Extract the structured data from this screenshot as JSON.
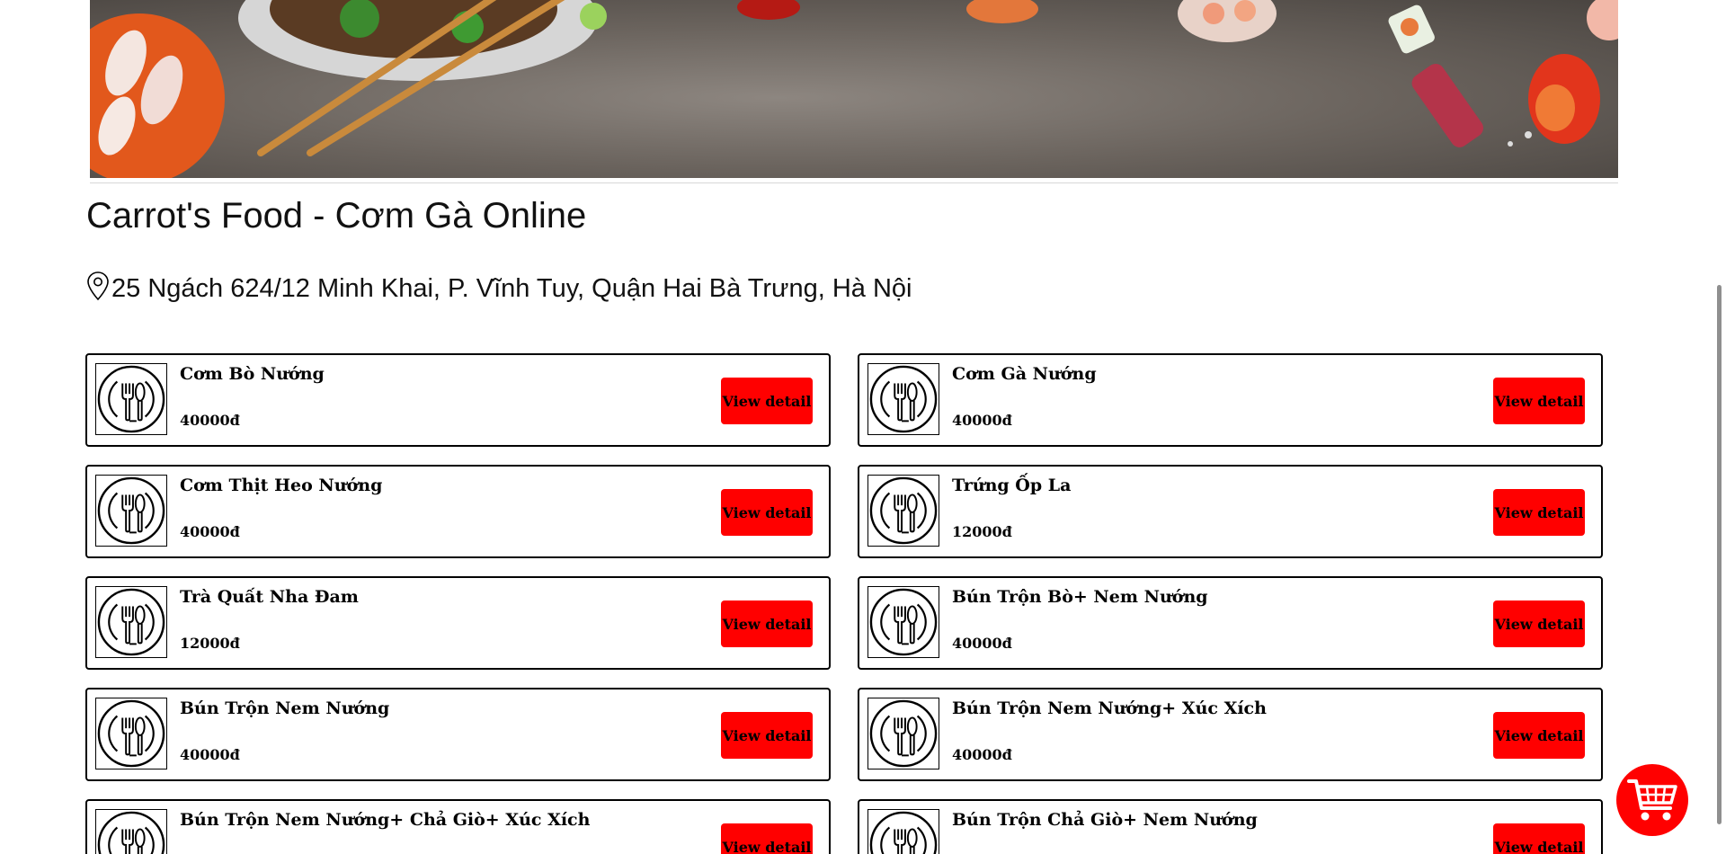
{
  "store": {
    "title": "Carrot's Food - Cơm Gà Online",
    "address": "25 Ngách 624/12 Minh Khai, P. Vĩnh Tuy, Quận Hai Bà Trưng, Hà Nội"
  },
  "menu": {
    "detail_label": "View detail",
    "items": [
      {
        "name": "Cơm Bò Nướng",
        "price": "40000đ"
      },
      {
        "name": "Cơm Gà Nướng",
        "price": "40000đ"
      },
      {
        "name": "Cơm Thịt Heo Nướng",
        "price": "40000đ"
      },
      {
        "name": "Trứng Ốp La",
        "price": "12000đ"
      },
      {
        "name": "Trà Quất Nha Đam",
        "price": "12000đ"
      },
      {
        "name": "Bún Trộn Bò+ Nem Nướng",
        "price": "40000đ"
      },
      {
        "name": "Bún Trộn Nem Nướng",
        "price": "40000đ"
      },
      {
        "name": "Bún Trộn Nem Nướng+ Xúc Xích",
        "price": "40000đ"
      },
      {
        "name": "Bún Trộn Nem Nướng+ Chả Giò+ Xúc Xích",
        "price": ""
      },
      {
        "name": "Bún Trộn Chả Giò+ Nem Nướng",
        "price": ""
      }
    ]
  },
  "icons": {
    "location": "map-pin-icon",
    "dish": "plate-fork-spoon-icon",
    "cart": "shopping-cart-icon"
  },
  "colors": {
    "accent": "#ff0000",
    "text": "#000000"
  }
}
